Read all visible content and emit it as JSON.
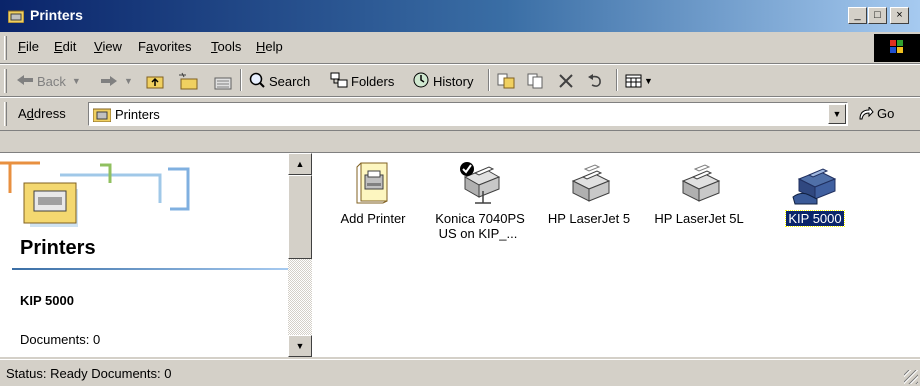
{
  "window": {
    "title": "Printers"
  },
  "menubar": {
    "items": [
      {
        "label": "File",
        "hotkey": "F",
        "rest": "ile"
      },
      {
        "label": "Edit",
        "hotkey": "E",
        "rest": "dit"
      },
      {
        "label": "View",
        "hotkey": "V",
        "rest": "iew"
      },
      {
        "label": "Favorites",
        "hotkey": "a",
        "pre": "F",
        "rest": "vorites"
      },
      {
        "label": "Tools",
        "hotkey": "T",
        "rest": "ools"
      },
      {
        "label": "Help",
        "hotkey": "H",
        "rest": "elp"
      }
    ]
  },
  "toolbar": {
    "back_label": "Back",
    "search_label": "Search",
    "folders_label": "Folders",
    "history_label": "History"
  },
  "address": {
    "label_pre": "A",
    "label_hot": "d",
    "label_rest": "dress",
    "value": "Printers",
    "go_label": "Go"
  },
  "left_pane": {
    "title": "Printers",
    "selected_name": "KIP 5000",
    "documents": "Documents: 0"
  },
  "items": [
    {
      "label": "Add Printer",
      "icon": "add-printer-icon"
    },
    {
      "label": "Konica 7040PS US on KIP_...",
      "icon": "printer-default-icon"
    },
    {
      "label": "HP LaserJet 5",
      "icon": "printer-icon"
    },
    {
      "label": "HP LaserJet 5L",
      "icon": "printer-icon"
    },
    {
      "label": "KIP 5000",
      "icon": "shared-printer-icon",
      "selected": true
    }
  ],
  "status": {
    "text": "Status: Ready Documents: 0"
  },
  "colors": {
    "title_start": "#0a246a",
    "title_end": "#a6caf0",
    "selection": "#0a246a"
  }
}
